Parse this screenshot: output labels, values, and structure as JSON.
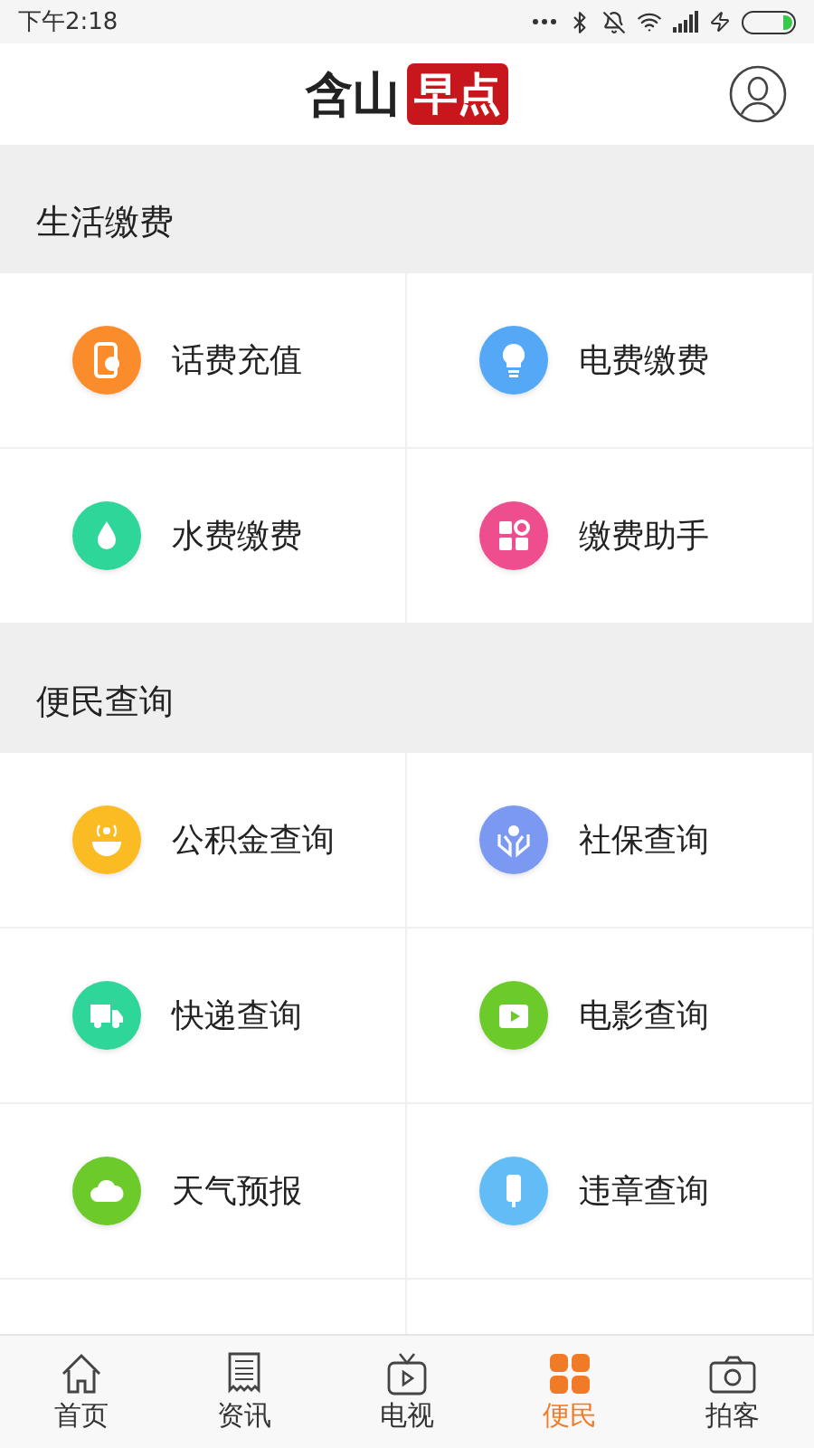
{
  "status_bar": {
    "time": "下午2:18"
  },
  "header": {
    "logo_left": "含山",
    "logo_right": "早点"
  },
  "sections": [
    {
      "title": "生活缴费",
      "items": [
        {
          "label": "话费充值",
          "color": "#fb8c2b"
        },
        {
          "label": "电费缴费",
          "color": "#55a8f5"
        },
        {
          "label": "水费缴费",
          "color": "#2fd69a"
        },
        {
          "label": "缴费助手",
          "color": "#ee4e8e"
        }
      ]
    },
    {
      "title": "便民查询",
      "items": [
        {
          "label": "公积金查询",
          "color": "#fbbb23"
        },
        {
          "label": "社保查询",
          "color": "#7b99f1"
        },
        {
          "label": "快递查询",
          "color": "#2fd69a"
        },
        {
          "label": "电影查询",
          "color": "#6ccb2a"
        },
        {
          "label": "天气预报",
          "color": "#6ccb2a"
        },
        {
          "label": "违章查询",
          "color": "#62bdf7"
        }
      ]
    }
  ],
  "tabs": [
    {
      "label": "首页",
      "selected": false
    },
    {
      "label": "资讯",
      "selected": false
    },
    {
      "label": "电视",
      "selected": false
    },
    {
      "label": "便民",
      "selected": true
    },
    {
      "label": "拍客",
      "selected": false
    }
  ]
}
